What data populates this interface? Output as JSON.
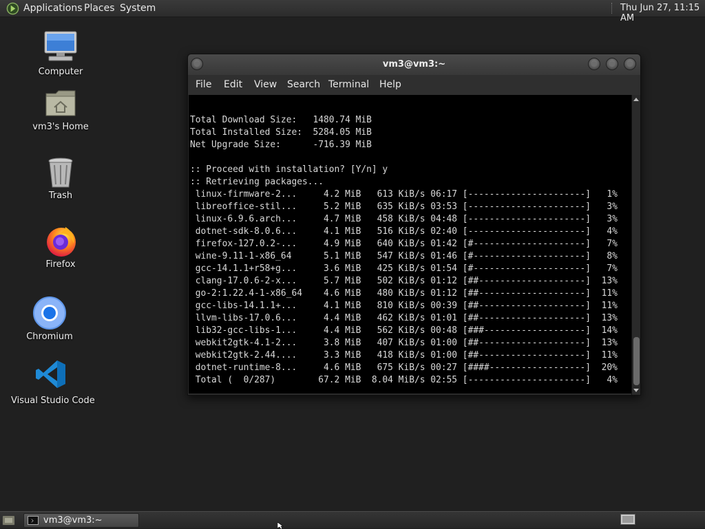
{
  "top_panel": {
    "menus": [
      "Applications",
      "Places",
      "System"
    ],
    "clock": "Thu Jun 27, 11:15 AM"
  },
  "desktop": {
    "icons": [
      {
        "label": "Computer",
        "icon": "computer-icon"
      },
      {
        "label": "vm3's Home",
        "icon": "home-folder-icon"
      },
      {
        "label": "Trash",
        "icon": "trash-icon"
      },
      {
        "label": "Firefox",
        "icon": "firefox-icon"
      },
      {
        "label": "Chromium",
        "icon": "chromium-icon"
      },
      {
        "label": "Visual Studio Code",
        "icon": "vscode-icon"
      }
    ]
  },
  "terminal_window": {
    "title": "vm3@vm3:~",
    "menu": [
      "File",
      "Edit",
      "View",
      "Search",
      "Terminal",
      "Help"
    ],
    "lines": [
      "",
      "Total Download Size:   1480.74 MiB",
      "Total Installed Size:  5284.05 MiB",
      "Net Upgrade Size:      -716.39 MiB",
      "",
      ":: Proceed with installation? [Y/n] y",
      ":: Retrieving packages...",
      " linux-firmware-2...     4.2 MiB   613 KiB/s 06:17 [----------------------]   1%",
      " libreoffice-stil...     5.2 MiB   635 KiB/s 03:53 [----------------------]   3%",
      " linux-6.9.6.arch...     4.7 MiB   458 KiB/s 04:48 [----------------------]   3%",
      " dotnet-sdk-8.0.6...     4.1 MiB   516 KiB/s 02:40 [----------------------]   4%",
      " firefox-127.0.2-...     4.9 MiB   640 KiB/s 01:42 [#---------------------]   7%",
      " wine-9.11-1-x86_64      5.1 MiB   547 KiB/s 01:46 [#---------------------]   8%",
      " gcc-14.1.1+r58+g...     3.6 MiB   425 KiB/s 01:54 [#---------------------]   7%",
      " clang-17.0.6-2-x...     5.7 MiB   502 KiB/s 01:12 [##--------------------]  13%",
      " go-2:1.22.4-1-x86_64    4.6 MiB   480 KiB/s 01:12 [##--------------------]  11%",
      " gcc-libs-14.1.1+...     4.1 MiB   810 KiB/s 00:39 [##--------------------]  11%",
      " llvm-libs-17.0.6...     4.4 MiB   462 KiB/s 01:01 [##--------------------]  13%",
      " lib32-gcc-libs-1...     4.4 MiB   562 KiB/s 00:48 [###-------------------]  14%",
      " webkit2gtk-4.1-2...     3.8 MiB   407 KiB/s 01:00 [##--------------------]  13%",
      " webkit2gtk-2.44....     3.3 MiB   418 KiB/s 01:00 [##--------------------]  11%",
      " dotnet-runtime-8...     4.6 MiB   675 KiB/s 00:27 [####------------------]  20%",
      " Total (  0/287)        67.2 MiB  8.04 MiB/s 02:55 [----------------------]   4%"
    ]
  },
  "taskbar": {
    "task_label": "vm3@vm3:~"
  }
}
